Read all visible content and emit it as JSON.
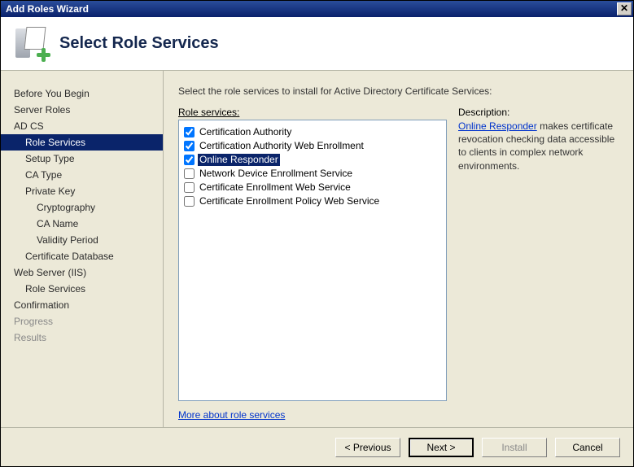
{
  "window": {
    "title": "Add Roles Wizard"
  },
  "header": {
    "title": "Select Role Services"
  },
  "sidebar": {
    "items": [
      {
        "label": "Before You Begin",
        "level": 1
      },
      {
        "label": "Server Roles",
        "level": 1
      },
      {
        "label": "AD CS",
        "level": 1
      },
      {
        "label": "Role Services",
        "level": 2,
        "selected": true
      },
      {
        "label": "Setup Type",
        "level": 2
      },
      {
        "label": "CA Type",
        "level": 2
      },
      {
        "label": "Private Key",
        "level": 2
      },
      {
        "label": "Cryptography",
        "level": 3
      },
      {
        "label": "CA Name",
        "level": 3
      },
      {
        "label": "Validity Period",
        "level": 3
      },
      {
        "label": "Certificate Database",
        "level": 2
      },
      {
        "label": "Web Server (IIS)",
        "level": 1
      },
      {
        "label": "Role Services",
        "level": 2
      },
      {
        "label": "Confirmation",
        "level": 1
      },
      {
        "label": "Progress",
        "level": 1,
        "disabled": true
      },
      {
        "label": "Results",
        "level": 1,
        "disabled": true
      }
    ]
  },
  "main": {
    "instruction": "Select the role services to install for Active Directory Certificate Services:",
    "role_services_label": "Role services:",
    "description_label": "Description:",
    "services": [
      {
        "label": "Certification Authority",
        "checked": true
      },
      {
        "label": "Certification Authority Web Enrollment",
        "checked": true
      },
      {
        "label": "Online Responder",
        "checked": true,
        "selected": true
      },
      {
        "label": "Network Device Enrollment Service",
        "checked": false
      },
      {
        "label": "Certificate Enrollment Web Service",
        "checked": false
      },
      {
        "label": "Certificate Enrollment Policy Web Service",
        "checked": false
      }
    ],
    "description_link": "Online Responder",
    "description_text": " makes certificate revocation checking data accessible to clients in complex network environments.",
    "more_link": "More about role services"
  },
  "footer": {
    "previous": "< Previous",
    "next": "Next >",
    "install": "Install",
    "cancel": "Cancel"
  }
}
